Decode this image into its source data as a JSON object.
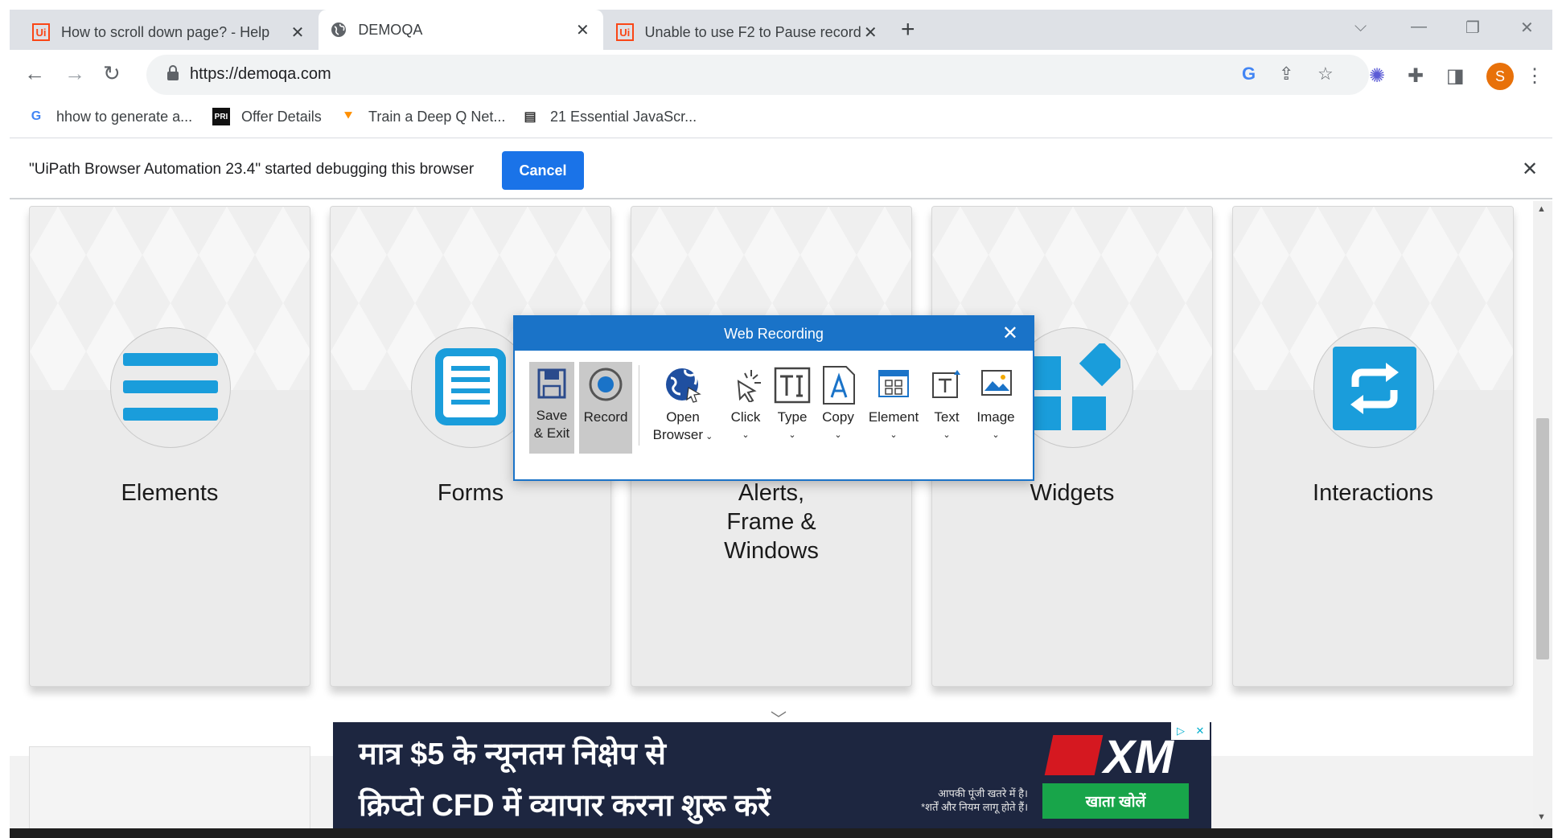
{
  "browser": {
    "tabs": [
      {
        "title": "How to scroll down page? - Help",
        "favicon": "ui-icon",
        "active": false
      },
      {
        "title": "DEMOQA",
        "favicon": "globe-icon",
        "active": true
      },
      {
        "title": "Unable to use F2 to Pause record",
        "favicon": "ui-icon",
        "active": false
      }
    ],
    "new_tab": "+",
    "address": {
      "url": "https://demoqa.com"
    },
    "profile_initial": "S",
    "bookmarks": [
      {
        "label": "hhow to generate a...",
        "icon": "google-icon"
      },
      {
        "label": "Offer Details",
        "icon": "pri-icon"
      },
      {
        "label": "Train a Deep Q Net...",
        "icon": "tensorflow-icon"
      },
      {
        "label": "21 Essential JavaScr...",
        "icon": "newspaper-icon"
      }
    ],
    "favicon_ui": "Ui"
  },
  "debug_bar": {
    "message": "\"UiPath Browser Automation 23.4\" started debugging this browser",
    "cancel_label": "Cancel"
  },
  "page": {
    "cards": [
      {
        "title": "Elements",
        "icon": "hamburger-icon"
      },
      {
        "title": "Forms",
        "icon": "document-icon"
      },
      {
        "title": "Alerts, Frame & Windows",
        "icon": "bell-icon"
      },
      {
        "title": "Widgets",
        "icon": "widgets-icon"
      },
      {
        "title": "Interactions",
        "icon": "swap-icon"
      }
    ]
  },
  "ad": {
    "line1": "मात्र $5 के न्यूनतम निक्षेप से",
    "line2": "क्रिप्टो CFD में  व्यापार करना शुरू करें",
    "small_line1": "आपकी पूंजी खतरे में है।",
    "small_line2": "*शर्तें और नियम लागू होते हैं।",
    "brand": "XM",
    "button": "खाता खोलें"
  },
  "recorder": {
    "title": "Web Recording",
    "buttons": [
      {
        "label1": "Save",
        "label2": "& Exit",
        "icon": "floppy-icon"
      },
      {
        "label1": "Record",
        "label2": "",
        "icon": "record-icon"
      },
      {
        "label1": "Open",
        "label2": "Browser",
        "icon": "globe-cursor-icon"
      },
      {
        "label1": "Click",
        "label2": "",
        "icon": "click-icon"
      },
      {
        "label1": "Type",
        "label2": "",
        "icon": "type-icon"
      },
      {
        "label1": "Copy",
        "label2": "",
        "icon": "copy-icon"
      },
      {
        "label1": "Element",
        "label2": "",
        "icon": "element-icon"
      },
      {
        "label1": "Text",
        "label2": "",
        "icon": "text-icon"
      },
      {
        "label1": "Image",
        "label2": "",
        "icon": "image-icon"
      }
    ]
  },
  "colors": {
    "accent": "#1a73e8",
    "recorder_blue": "#1a73c8",
    "card_icon": "#1a9ddb",
    "profile": "#e8710a"
  }
}
